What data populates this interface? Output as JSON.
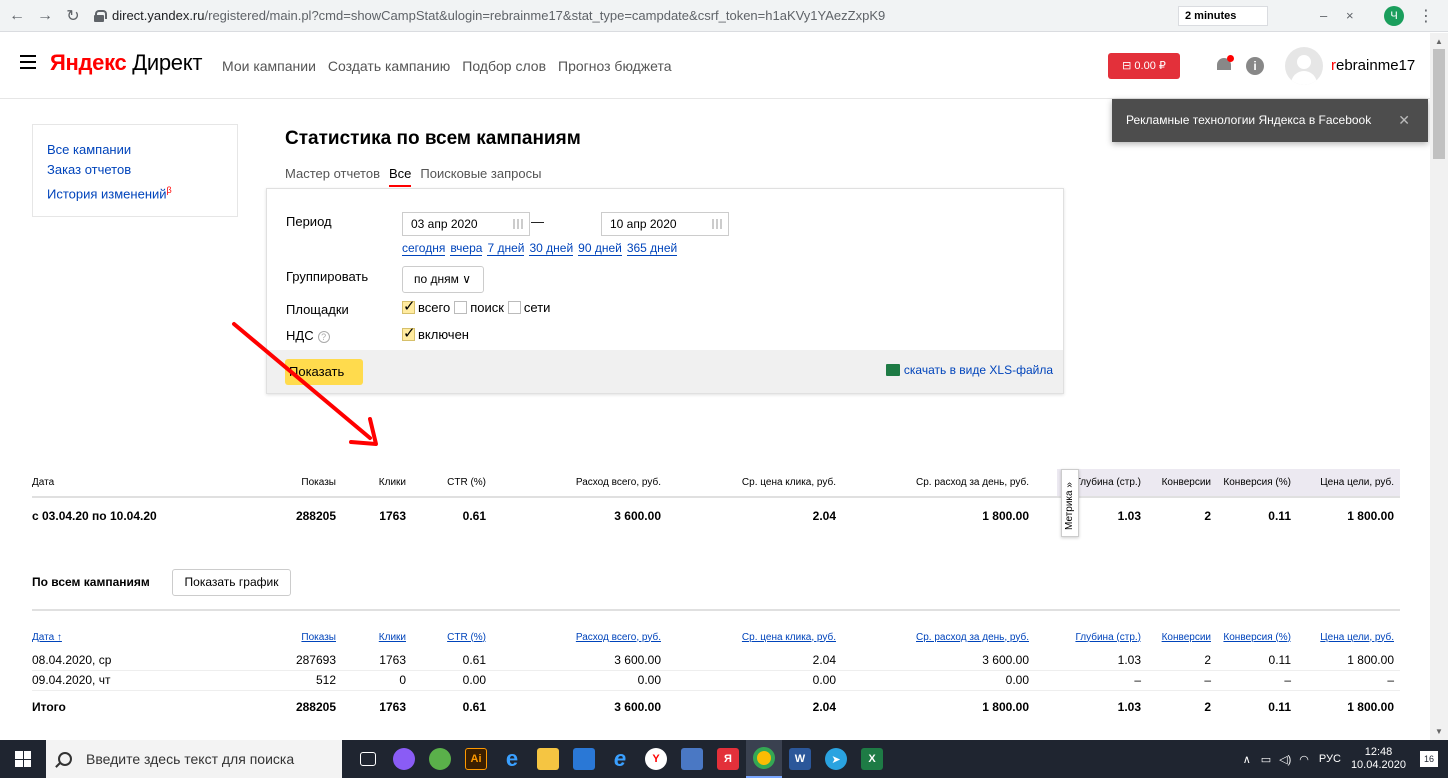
{
  "browser": {
    "url_host": "direct.yandex.ru",
    "url_rest": "/registered/main.pl?cmd=showCampStat&ulogin=rebrainme17&stat_type=campdate&csrf_token=h1aKVy1YAezZxpK9",
    "timer": "2 minutes",
    "profile_letter": "Ч"
  },
  "header": {
    "logo_ya": "Яндекс",
    "logo_direct": "Директ",
    "nav": [
      "Мои кампании",
      "Создать кампанию",
      "Подбор слов",
      "Прогноз бюджета"
    ],
    "balance": "0.00 ₽",
    "username_first": "r",
    "username_rest": "ebrainme17"
  },
  "toast": {
    "text": "Рекламные технологии Яндекса в Facebook",
    "close": "✕"
  },
  "leftmenu": {
    "all_campaigns": "Все кампании",
    "order_reports": "Заказ отчетов",
    "history": "История изменений",
    "beta": "β"
  },
  "page": {
    "title": "Статистика по всем кампаниям",
    "tabs": [
      "Мастер отчетов",
      "Все",
      "Поисковые запросы"
    ]
  },
  "filters": {
    "period_label": "Период",
    "date_from": "03 апр 2020",
    "date_to": "10 апр 2020",
    "dash": "—",
    "quick_ranges": [
      "сегодня",
      "вчера",
      "7 дней",
      "30 дней",
      "90 дней",
      "365 дней"
    ],
    "group_label": "Группировать",
    "group_value": "по дням",
    "group_chevron": "∨",
    "sites_label": "Площадки",
    "sites": [
      {
        "label": "всего",
        "checked": true
      },
      {
        "label": "поиск",
        "checked": false
      },
      {
        "label": "сети",
        "checked": false
      }
    ],
    "vat_label": "НДС",
    "vat_help": "?",
    "vat_value": "включен",
    "show_button": "Показать",
    "xls_link": "скачать в виде XLS-файла"
  },
  "summary": {
    "headers": [
      "Дата",
      "Показы",
      "Клики",
      "CTR (%)",
      "Расход всего, руб.",
      "Ср. цена клика, руб.",
      "Ср. расход за день, руб.",
      "Глубина (стр.)",
      "Конверсии",
      "Конверсия (%)",
      "Цена цели, руб."
    ],
    "row": [
      "с 03.04.20 по 10.04.20",
      "288205",
      "1763",
      "0.61",
      "3 600.00",
      "2.04",
      "1 800.00",
      "1.03",
      "2",
      "0.11",
      "1 800.00"
    ],
    "metrika_tab": "Метрика »"
  },
  "bycampaign": {
    "label": "По всем кампаниям",
    "graph_button": "Показать график",
    "headers": [
      "Дата ↑",
      "Показы",
      "Клики",
      "CTR (%)",
      "Расход всего, руб.",
      "Ср. цена клика, руб.",
      "Ср. расход за день, руб.",
      "Глубина (стр.)",
      "Конверсии",
      "Конверсия (%)",
      "Цена цели, руб."
    ],
    "rows": [
      [
        "08.04.2020, ср",
        "287693",
        "1763",
        "0.61",
        "3 600.00",
        "2.04",
        "3 600.00",
        "1.03",
        "2",
        "0.11",
        "1 800.00"
      ],
      [
        "09.04.2020, чт",
        "512",
        "0",
        "0.00",
        "0.00",
        "0.00",
        "0.00",
        "–",
        "–",
        "–",
        "–"
      ]
    ],
    "total": [
      "Итого",
      "288205",
      "1763",
      "0.61",
      "3 600.00",
      "2.04",
      "1 800.00",
      "1.03",
      "2",
      "0.11",
      "1 800.00"
    ]
  },
  "taskbar": {
    "search_placeholder": "Введите здесь текст для поиска",
    "lang": "РУС",
    "time": "12:48",
    "date": "10.04.2020",
    "notifications": "16"
  },
  "colors": {
    "accent_red": "#f00",
    "balance_red": "#e3303a",
    "button_yellow": "#ffdb4d",
    "link_blue": "#0044bb"
  }
}
